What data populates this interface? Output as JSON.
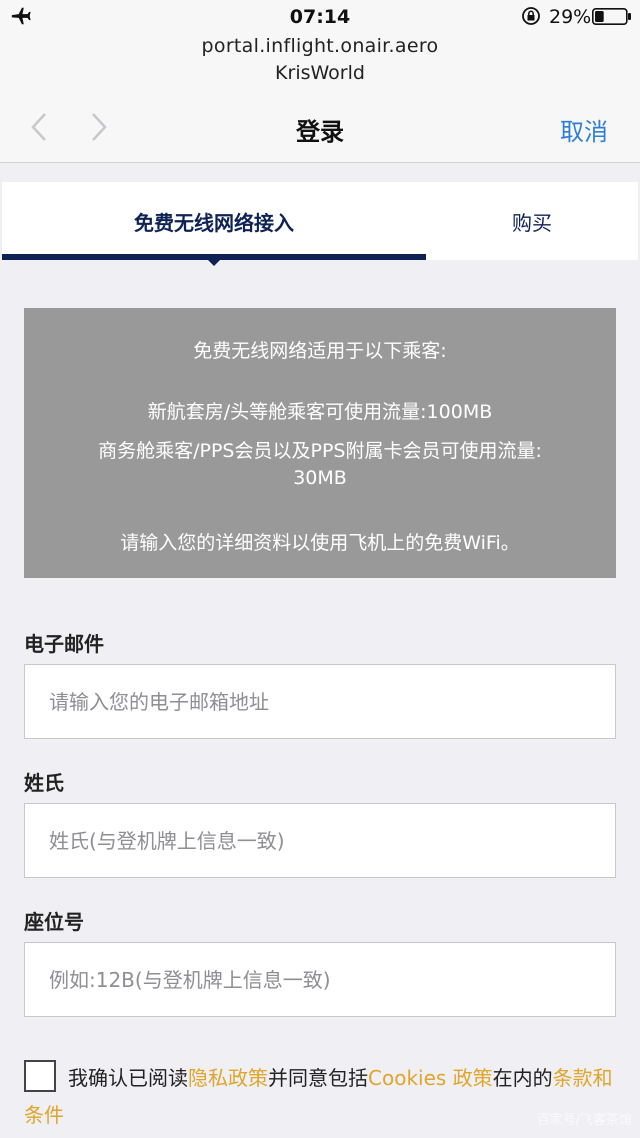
{
  "status_bar": {
    "time": "07:14",
    "battery_percent": "29%",
    "battery_level": 0.29
  },
  "url_bar": {
    "host": "portal.inflight.onair.aero",
    "site_name": "KrisWorld"
  },
  "nav": {
    "title": "登录",
    "cancel_label": "取消"
  },
  "tabs": [
    {
      "label": "免费无线网络接入",
      "active": true
    },
    {
      "label": "购买",
      "active": false
    }
  ],
  "info": {
    "heading": "免费无线网络适用于以下乘客:",
    "line1": "新航套房/头等舱乘客可使用流量:100MB",
    "line2": "商务舱乘客/PPS会员以及PPS附属卡会员可使用流量:",
    "line2b": "30MB",
    "line3": "请输入您的详细资料以使用飞机上的免费WiFi。"
  },
  "form": {
    "email": {
      "label": "电子邮件",
      "placeholder": "请输入您的电子邮箱地址",
      "value": ""
    },
    "surname": {
      "label": "姓氏",
      "placeholder": "姓氏(与登机牌上信息一致)",
      "value": ""
    },
    "seat": {
      "label": "座位号",
      "placeholder": "例如:12B(与登机牌上信息一致)",
      "value": ""
    }
  },
  "consent": {
    "checked": false,
    "text_1": "我确认已阅读",
    "privacy_link": "隐私政策",
    "text_2": "并同意包括",
    "cookies_link": "Cookies 政策",
    "text_3": "在内的",
    "terms_link": "条款和条件"
  },
  "watermark": "百家号/飞客茶馆",
  "colors": {
    "accent_navy": "#0e2255",
    "link_blue": "#2f7fd6",
    "link_gold": "#e0a52a",
    "info_bg": "#999999"
  }
}
